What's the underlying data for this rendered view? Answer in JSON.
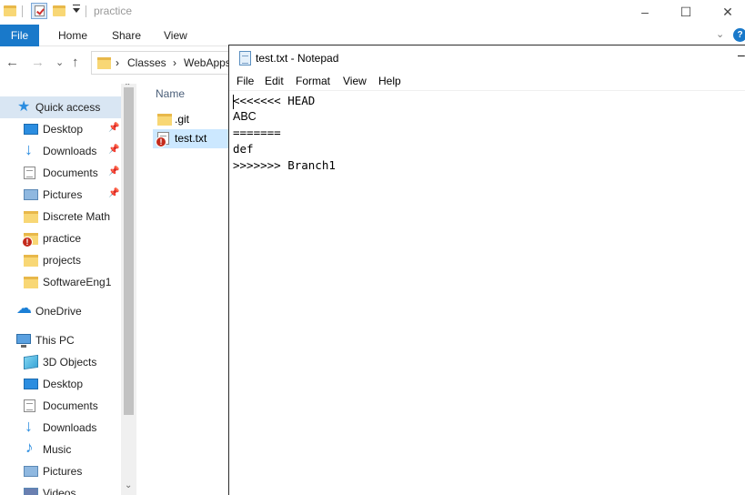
{
  "explorer": {
    "title": "practice",
    "window_controls": {
      "minimize": "–",
      "maximize": "☐",
      "close": "✕"
    },
    "ribbon": {
      "tabs": [
        "File",
        "Home",
        "Share",
        "View"
      ],
      "expand": "⌄",
      "help": "?"
    },
    "address": {
      "back": "←",
      "forward": "→",
      "recent": "⌄",
      "up": "↑",
      "chevron1": "›",
      "chevron2": "›",
      "crumbs": [
        "Classes",
        "WebApps"
      ]
    },
    "nav": {
      "scroll_up": "⌃",
      "scroll_down": "⌄",
      "items": [
        {
          "label": "Quick access",
          "icon": "star-icon",
          "selected": true
        },
        {
          "label": "Desktop",
          "icon": "desktop-icon",
          "pinned": true
        },
        {
          "label": "Downloads",
          "icon": "download-icon",
          "pinned": true
        },
        {
          "label": "Documents",
          "icon": "documents-icon",
          "pinned": true
        },
        {
          "label": "Pictures",
          "icon": "pictures-icon",
          "pinned": true
        },
        {
          "label": "Discrete Math",
          "icon": "folder-icon"
        },
        {
          "label": "practice",
          "icon": "folder-conflict-icon"
        },
        {
          "label": "projects",
          "icon": "folder-icon"
        },
        {
          "label": "SoftwareEng1",
          "icon": "folder-icon"
        },
        {
          "label": "OneDrive",
          "icon": "cloud-icon"
        },
        {
          "label": "This PC",
          "icon": "computer-icon"
        },
        {
          "label": "3D Objects",
          "icon": "3d-objects-icon"
        },
        {
          "label": "Desktop",
          "icon": "desktop-icon"
        },
        {
          "label": "Documents",
          "icon": "documents-icon"
        },
        {
          "label": "Downloads",
          "icon": "download-icon"
        },
        {
          "label": "Music",
          "icon": "music-icon"
        },
        {
          "label": "Pictures",
          "icon": "pictures-icon"
        },
        {
          "label": "Videos",
          "icon": "videos-icon"
        }
      ],
      "pin_glyph": "📌"
    },
    "files": {
      "column_name": "Name",
      "rows": [
        {
          "name": ".git",
          "icon": "folder-icon"
        },
        {
          "name": "test.txt",
          "icon": "text-file-conflict-icon",
          "selected": true
        }
      ],
      "conflict_badge": "!"
    }
  },
  "notepad": {
    "title": "test.txt - Notepad",
    "minimize": "–",
    "menu": [
      "File",
      "Edit",
      "Format",
      "View",
      "Help"
    ],
    "lines": [
      "<<<<<<< HEAD",
      "ABC",
      "=======",
      "def",
      ">>>>>>> Branch1"
    ]
  },
  "colors": {
    "accent": "#1979ca",
    "selection": "#cce8ff",
    "nav_selected": "#d9e6f3",
    "folder": "#f8d775",
    "conflict": "#c42b1c"
  }
}
